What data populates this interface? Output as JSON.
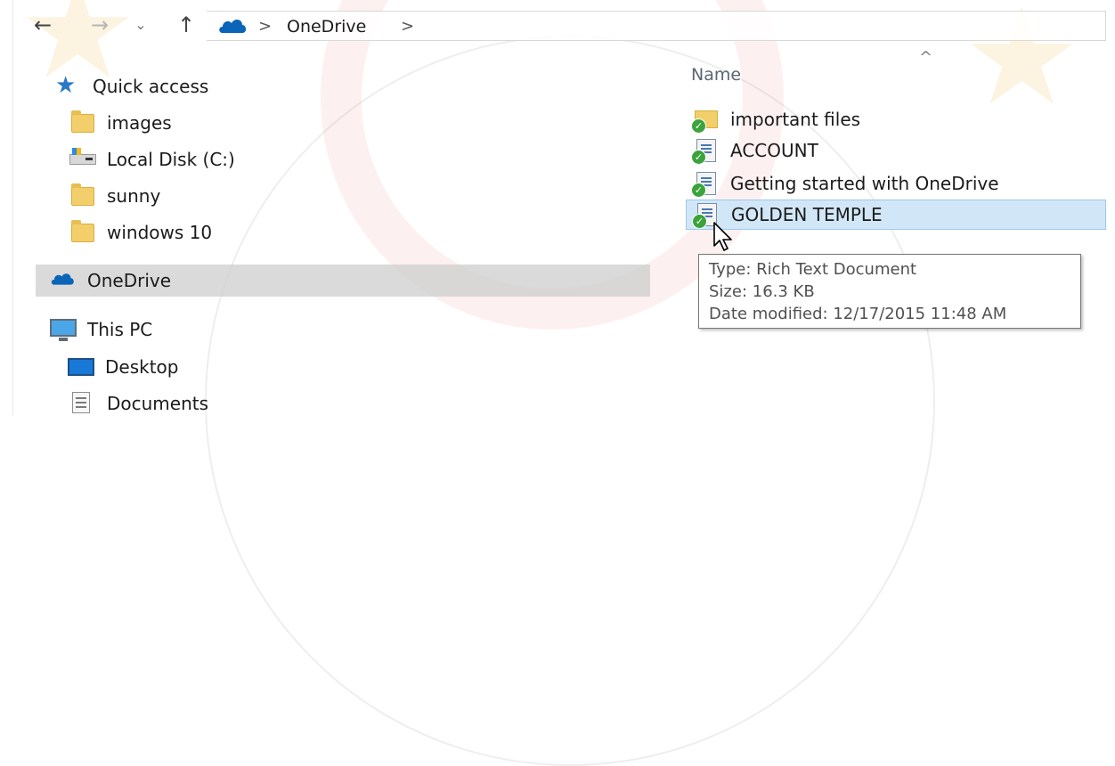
{
  "window": {
    "icons": {
      "back": "back-arrow-icon",
      "forward": "forward-arrow-icon",
      "recent": "chevron-down-icon",
      "up": "up-arrow-icon"
    }
  },
  "address_bar": {
    "root_icon": "onedrive-cloud-icon",
    "segments": [
      "OneDrive"
    ],
    "separator": ">"
  },
  "navigation_pane": {
    "items": [
      {
        "label": "Quick access",
        "icon": "star-pin-icon"
      },
      {
        "label": "images",
        "icon": "folder-icon"
      },
      {
        "label": "Local Disk (C:)",
        "icon": "drive-icon"
      },
      {
        "label": "sunny",
        "icon": "folder-icon"
      },
      {
        "label": "windows 10",
        "icon": "folder-icon"
      },
      {
        "label": "OneDrive",
        "icon": "onedrive-cloud-icon",
        "selected": true
      },
      {
        "label": "This PC",
        "icon": "computer-icon"
      },
      {
        "label": "Desktop",
        "icon": "desktop-icon"
      },
      {
        "label": "Documents",
        "icon": "documents-icon"
      }
    ]
  },
  "file_list": {
    "columns": [
      {
        "label": "Name",
        "sort": "ascending"
      }
    ],
    "sort_caret": "^",
    "files": [
      {
        "name": "important files",
        "type": "folder",
        "sync": "synced"
      },
      {
        "name": "ACCOUNT",
        "type": "rtf",
        "sync": "synced"
      },
      {
        "name": "Getting started with OneDrive",
        "type": "rtf",
        "sync": "synced"
      },
      {
        "name": "GOLDEN TEMPLE",
        "type": "rtf",
        "sync": "synced",
        "selected": true
      }
    ]
  },
  "tooltip": {
    "type": "Type: Rich Text Document",
    "size": "Size: 16.3 KB",
    "date_modified": "Date modified: 12/17/2015 11:48 AM"
  },
  "colors": {
    "selection_bg": "#cce4f7",
    "selection_border": "#99c9ef",
    "nav_selected_bg": "#cdcdcd",
    "sync_check": "#3ca33c",
    "onedrive_blue": "#0a64b8"
  }
}
